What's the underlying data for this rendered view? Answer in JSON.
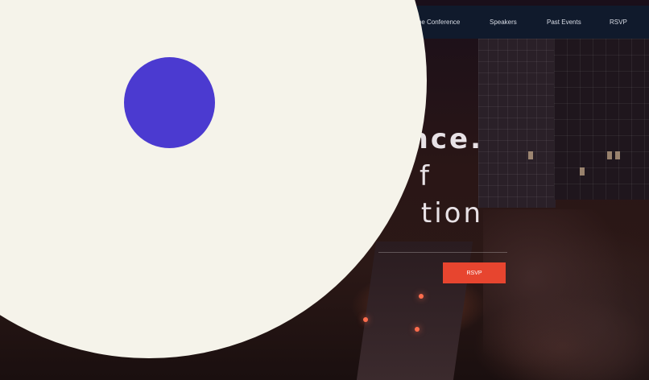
{
  "nav": {
    "items": [
      {
        "label": "The Conference"
      },
      {
        "label": "Speakers"
      },
      {
        "label": "Past Events"
      },
      {
        "label": "RSVP"
      }
    ]
  },
  "hero": {
    "headline_lines": [
      "nce.",
      "f",
      "tion"
    ],
    "cta_label": "RSVP"
  },
  "colors": {
    "nav_bg": "#101a2c",
    "cta": "#e7452f",
    "overlay": "#f5f3ea",
    "dot": "#4b3ad0"
  }
}
